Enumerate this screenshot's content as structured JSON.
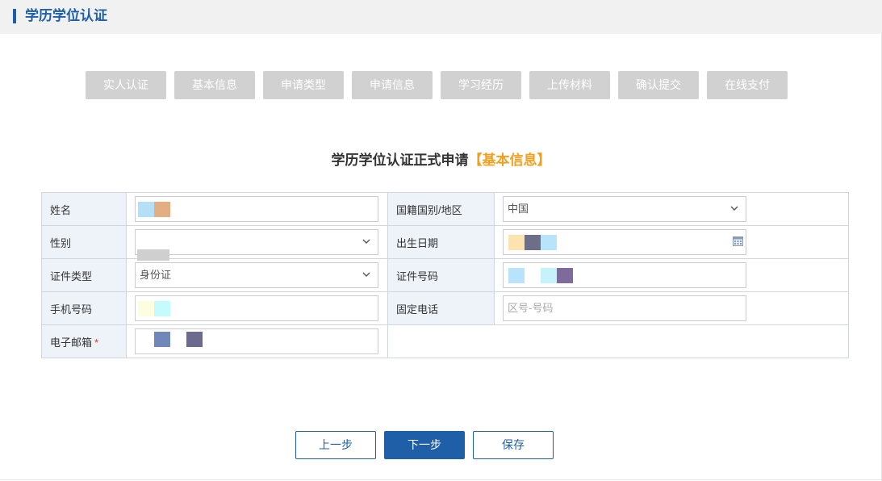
{
  "header": {
    "title": "学历学位认证"
  },
  "steps": [
    {
      "label": "实人认证"
    },
    {
      "label": "基本信息"
    },
    {
      "label": "申请类型"
    },
    {
      "label": "申请信息"
    },
    {
      "label": "学习经历"
    },
    {
      "label": "上传材料"
    },
    {
      "label": "确认提交"
    },
    {
      "label": "在线支付"
    }
  ],
  "form": {
    "title": "学历学位认证正式申请",
    "title_accent": "【基本信息】",
    "fields": {
      "name": {
        "label": "姓名"
      },
      "nationality": {
        "label": "国籍国别/地区",
        "value": "中国"
      },
      "gender": {
        "label": "性别",
        "value": ""
      },
      "birth_date": {
        "label": "出生日期"
      },
      "id_type": {
        "label": "证件类型",
        "value": "身份证"
      },
      "id_number": {
        "label": "证件号码"
      },
      "mobile": {
        "label": "手机号码"
      },
      "landline": {
        "label": "固定电话",
        "placeholder": "区号-号码"
      },
      "email": {
        "label": "电子邮箱",
        "required_mark": "*"
      }
    }
  },
  "buttons": {
    "prev": "上一步",
    "next": "下一步",
    "save": "保存"
  },
  "colors": {
    "accent_blue": "#1e5fa8",
    "accent_orange": "#f0a020",
    "step_inactive": "#d1d1d1",
    "label_bg": "#eef3f9",
    "required_red": "#e23333"
  },
  "icons": {
    "select_arrow": "chevron-down-icon",
    "date_picker": "calendar-icon"
  }
}
